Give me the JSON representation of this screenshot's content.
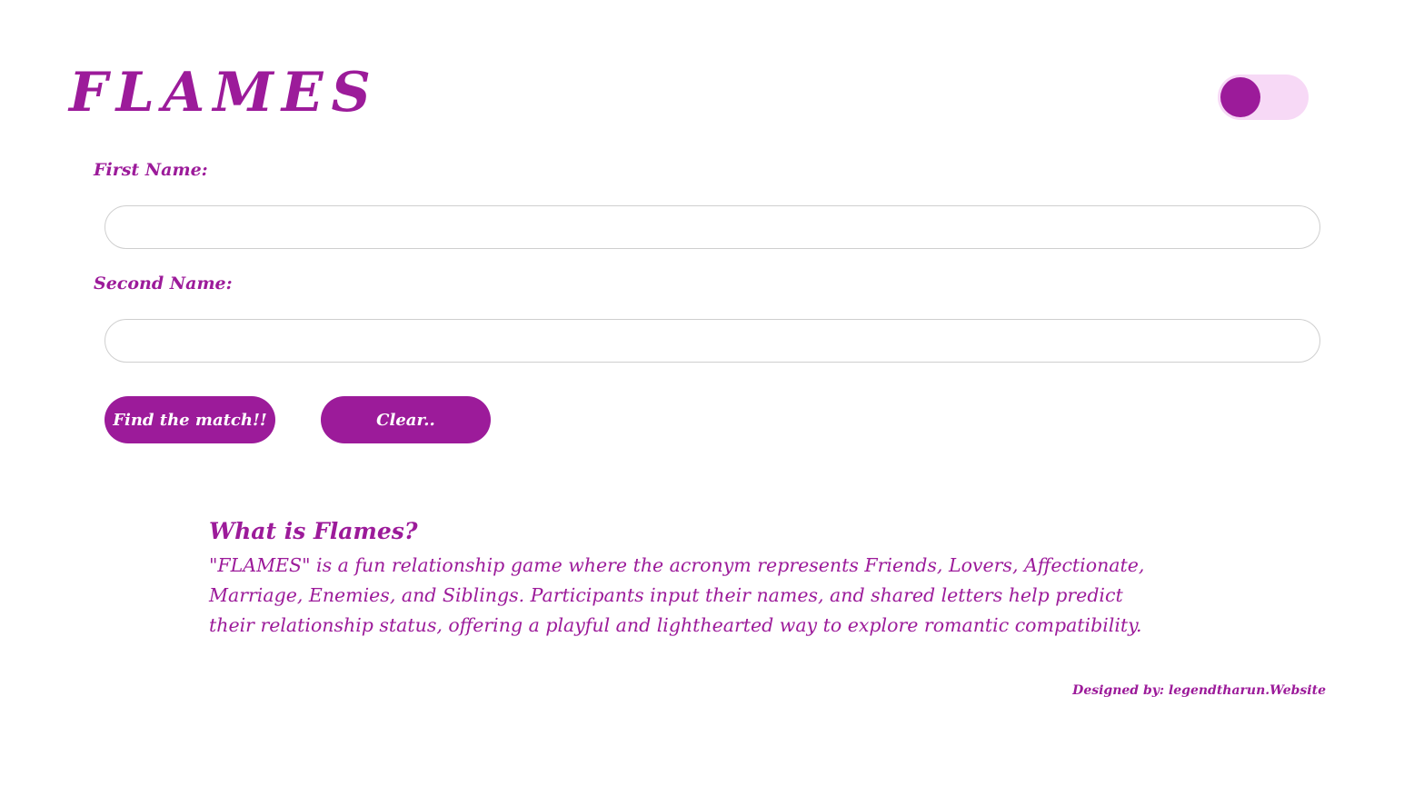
{
  "header": {
    "title": "FLAMES",
    "theme_toggle": {
      "state": "off"
    }
  },
  "form": {
    "first_name_label": "First Name:",
    "first_name_value": "",
    "second_name_label": "Second Name:",
    "second_name_value": "",
    "find_button_label": "Find the match!!",
    "clear_button_label": "Clear.."
  },
  "about": {
    "heading": "What is Flames?",
    "text": "\"FLAMES\" is a fun relationship game where the acronym represents Friends, Lovers, Affectionate, Marriage, Enemies, and Siblings. Participants input their names, and shared letters help predict their relationship status, offering a playful and lighthearted way to explore romantic compatibility."
  },
  "footer": {
    "credit": "Designed by: legendtharun.Website"
  },
  "colors": {
    "accent": "#9c1b9a",
    "toggle_track": "#f7d9f6",
    "input_border": "#cfcfcf",
    "background": "#ffffff"
  },
  "icons": {
    "theme_toggle": "toggle-switch-icon"
  }
}
